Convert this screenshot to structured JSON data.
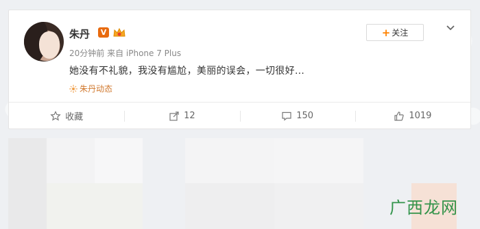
{
  "post": {
    "author_name": "朱丹",
    "verified_badge": "V",
    "meta_line": "20分钟前 来自 iPhone 7 Plus",
    "text": "她没有不礼貌，我没有尴尬，美丽的误会，一切很好…",
    "topic_label": "朱丹动态",
    "follow_label": "+关注",
    "follow_text": "关注"
  },
  "actions": [
    {
      "label": "收藏",
      "icon": "star-icon"
    },
    {
      "label": "12",
      "icon": "repost-icon"
    },
    {
      "label": "150",
      "icon": "comment-icon"
    },
    {
      "label": "1019",
      "icon": "like-icon"
    }
  ],
  "watermark": "广西龙网",
  "colors": {
    "accent_orange": "#ff8200",
    "verified_orange": "#e86b0f",
    "topic_orange": "#d17a30",
    "watermark_green": "#1f8b3b"
  }
}
